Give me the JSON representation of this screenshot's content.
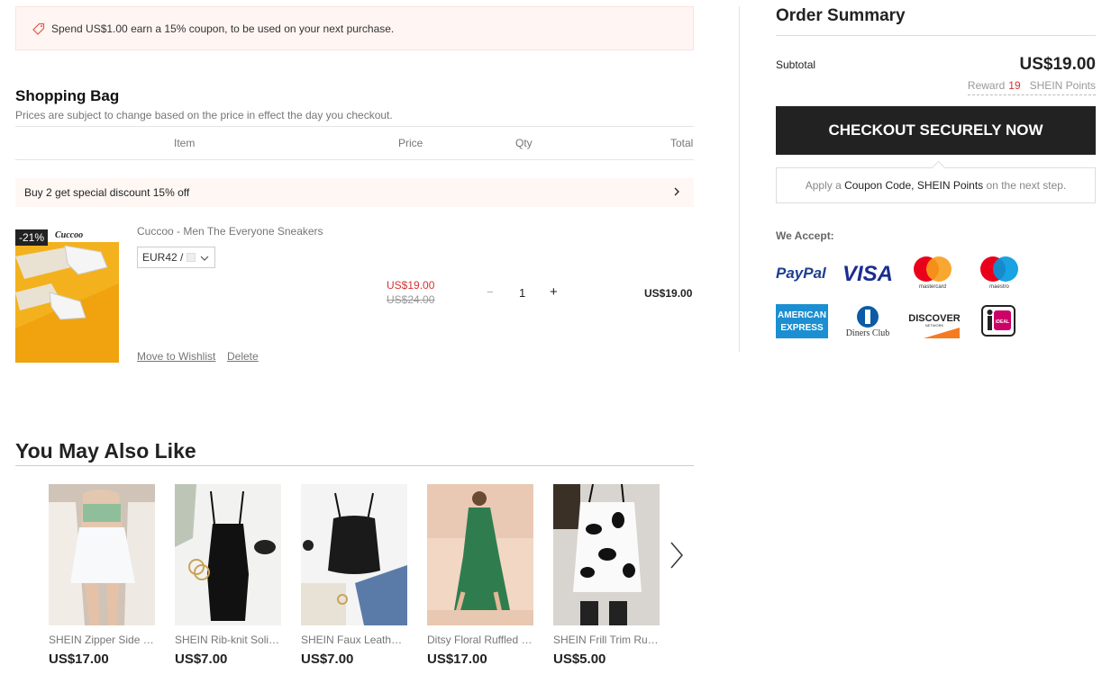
{
  "promo": {
    "text": "Spend US$1.00 earn a 15% coupon, to be used on your next purchase.",
    "icon": "tag-icon"
  },
  "bag": {
    "title": "Shopping Bag",
    "subtitle": "Prices are subject to change based on the price in effect the day you checkout.",
    "columns": {
      "item": "Item",
      "price": "Price",
      "qty": "Qty",
      "total": "Total"
    },
    "discount_text": "Buy 2 get special discount 15% off",
    "item": {
      "badge": "-21%",
      "brand_logo": "Cuccoo",
      "name": "Cuccoo - Men The Everyone Sneakers",
      "size": "EUR42 /",
      "sale_price": "US$19.00",
      "orig_price": "US$24.00",
      "qty_minus": "−",
      "qty": "1",
      "qty_plus": "+",
      "total": "US$19.00",
      "move_to_wishlist": "Move to Wishlist",
      "delete": "Delete"
    }
  },
  "summary": {
    "title": "Order Summary",
    "subtotal_label": "Subtotal",
    "subtotal_value": "US$19.00",
    "reward_prefix": "Reward",
    "reward_points": "19",
    "reward_suffix": "SHEIN Points",
    "checkout_label": "CHECKOUT SECURELY NOW",
    "coupon_apply": "Apply a",
    "coupon_code": "Coupon Code, SHEIN Points",
    "coupon_suffix": "on the next step.",
    "we_accept": "We Accept:",
    "payments": {
      "paypal": "PayPal",
      "visa": "VISA",
      "mastercard": "mastercard",
      "maestro": "maestro",
      "amex_1": "AMERICAN",
      "amex_2": "EXPRESS",
      "diners": "Diners Club",
      "discover": "DISCOVER",
      "discover_sub": "NETWORK",
      "ideal": "iDEAL"
    }
  },
  "recommend": {
    "title": "You May Also Like",
    "items": [
      {
        "name": "SHEIN Zipper Side Pleated Skirt",
        "price": "US$17.00"
      },
      {
        "name": "SHEIN Rib-knit Solid Cami Dress",
        "price": "US$7.00"
      },
      {
        "name": "SHEIN Faux Leather Bustier Top",
        "price": "US$7.00"
      },
      {
        "name": "Ditsy Floral Ruffled Hem Dress",
        "price": "US$17.00"
      },
      {
        "name": "SHEIN Frill Trim Ruched Cami Top",
        "price": "US$5.00"
      }
    ]
  },
  "colors": {
    "accent_red": "#d53333",
    "dark": "#222222",
    "promo_bg": "#fff6f3"
  }
}
